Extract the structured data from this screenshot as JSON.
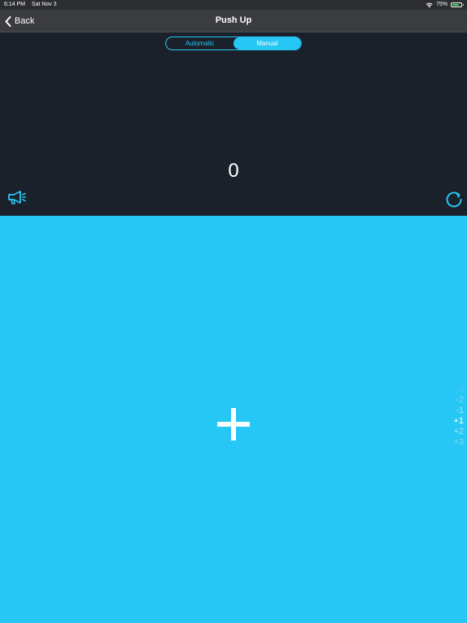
{
  "status_bar": {
    "time": "6:14 PM",
    "date": "Sat Nov 3",
    "battery_percent": "75%",
    "battery_level": 0.75,
    "icons": [
      "wifi-icon",
      "battery-icon"
    ]
  },
  "nav": {
    "back_label": "Back",
    "back_icon": "chevron-left-icon",
    "title": "Push Up"
  },
  "mode_switch": {
    "options": [
      "Automatic",
      "Manual"
    ],
    "selected": "Manual"
  },
  "counter": {
    "value": "0"
  },
  "controls": {
    "sound_icon": "megaphone-icon",
    "reset_icon": "refresh-icon",
    "add_icon": "plus-icon"
  },
  "step_picker": {
    "options": [
      "-3",
      "-2",
      "-1",
      "+1",
      "+2",
      "+3"
    ],
    "selected": "+1"
  },
  "colors": {
    "accent": "#27c7f5",
    "dark_background": "#1b212b",
    "nav_background": "#3a3c40"
  }
}
